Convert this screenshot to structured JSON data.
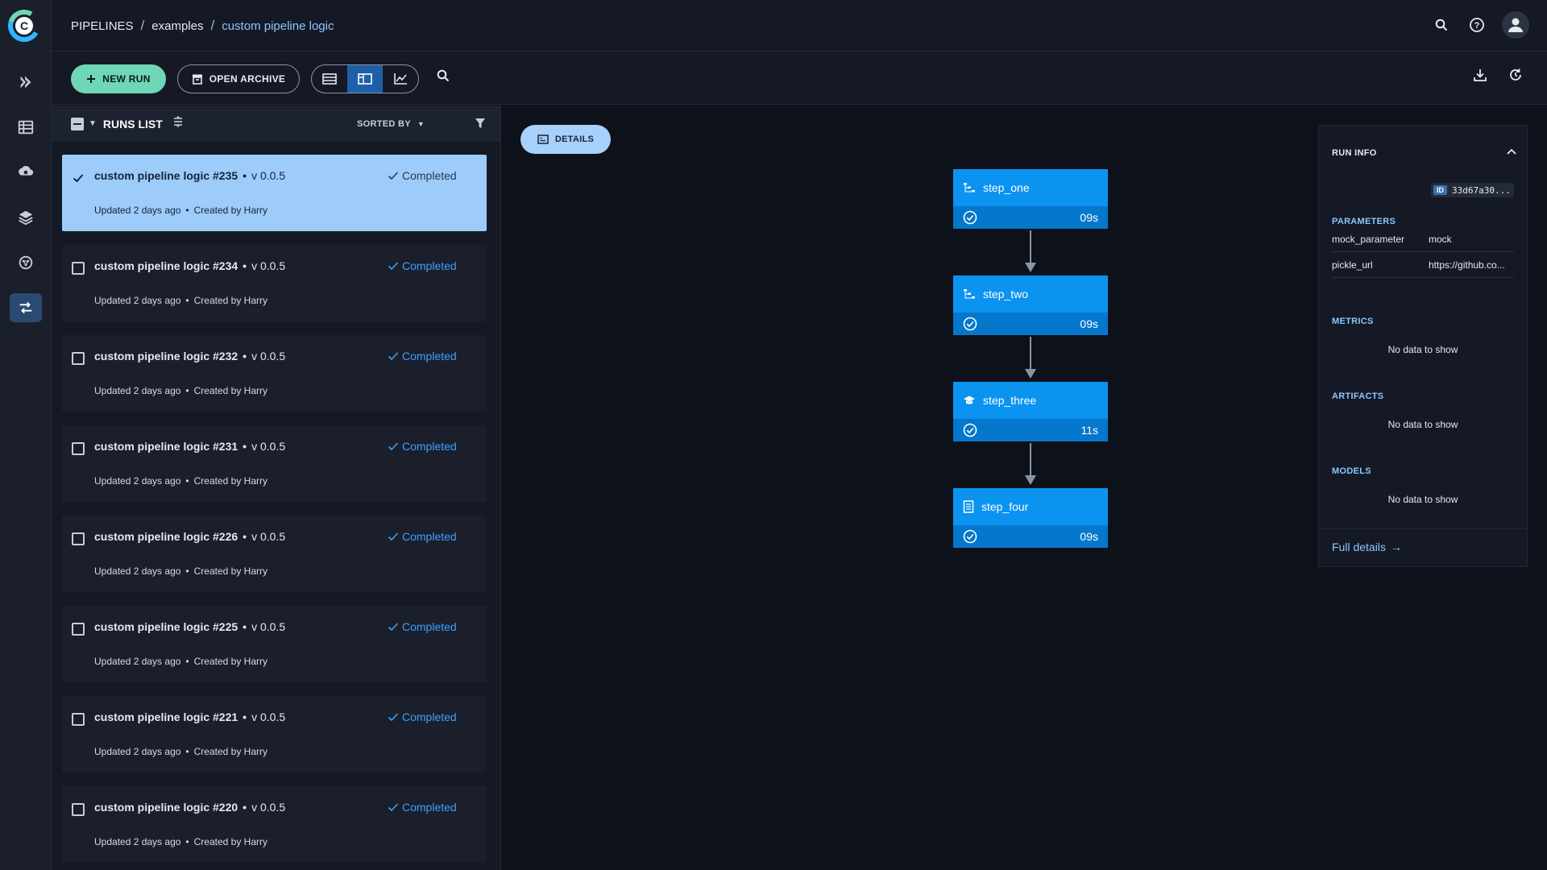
{
  "breadcrumb": {
    "root": "PIPELINES",
    "project": "examples",
    "current": "custom pipeline logic",
    "separator": "/"
  },
  "toolbar": {
    "new_run": "NEW RUN",
    "open_archive": "OPEN ARCHIVE"
  },
  "runs_list": {
    "title": "RUNS LIST",
    "sorted_by": "SORTED BY",
    "dot": "•",
    "runs": [
      {
        "name": "custom pipeline logic #235",
        "version": "v 0.0.5",
        "status": "Completed",
        "updated": "Updated 2 days ago",
        "created": "Created by Harry",
        "selected": true
      },
      {
        "name": "custom pipeline logic #234",
        "version": "v 0.0.5",
        "status": "Completed",
        "updated": "Updated 2 days ago",
        "created": "Created by Harry",
        "selected": false
      },
      {
        "name": "custom pipeline logic #232",
        "version": "v 0.0.5",
        "status": "Completed",
        "updated": "Updated 2 days ago",
        "created": "Created by Harry",
        "selected": false
      },
      {
        "name": "custom pipeline logic #231",
        "version": "v 0.0.5",
        "status": "Completed",
        "updated": "Updated 2 days ago",
        "created": "Created by Harry",
        "selected": false
      },
      {
        "name": "custom pipeline logic #226",
        "version": "v 0.0.5",
        "status": "Completed",
        "updated": "Updated 2 days ago",
        "created": "Created by Harry",
        "selected": false
      },
      {
        "name": "custom pipeline logic #225",
        "version": "v 0.0.5",
        "status": "Completed",
        "updated": "Updated 2 days ago",
        "created": "Created by Harry",
        "selected": false
      },
      {
        "name": "custom pipeline logic #221",
        "version": "v 0.0.5",
        "status": "Completed",
        "updated": "Updated 2 days ago",
        "created": "Created by Harry",
        "selected": false
      },
      {
        "name": "custom pipeline logic #220",
        "version": "v 0.0.5",
        "status": "Completed",
        "updated": "Updated 2 days ago",
        "created": "Created by Harry",
        "selected": false
      }
    ]
  },
  "details_button": "DETAILS",
  "steps": [
    {
      "name": "step_one",
      "duration": "09s",
      "icon": "steps-icon"
    },
    {
      "name": "step_two",
      "duration": "09s",
      "icon": "steps-icon"
    },
    {
      "name": "step_three",
      "duration": "11s",
      "icon": "training-icon"
    },
    {
      "name": "step_four",
      "duration": "09s",
      "icon": "document-icon"
    }
  ],
  "run_info": {
    "title": "RUN INFO",
    "id_tag": "ID",
    "id_value": "33d67a30...",
    "parameters_label": "PARAMETERS",
    "parameters": [
      {
        "key": "mock_parameter",
        "value": "mock"
      },
      {
        "key": "pickle_url",
        "value": "https://github.co..."
      }
    ],
    "metrics_label": "METRICS",
    "artifacts_label": "ARTIFACTS",
    "models_label": "MODELS",
    "no_data": "No data to show",
    "full_details": "Full details",
    "full_details_arrow": "→"
  },
  "colors": {
    "accent": "#0b93f0",
    "new_run": "#6fd7b6",
    "selected_card": "#9dcbfa",
    "status": "#3ea0ff"
  }
}
